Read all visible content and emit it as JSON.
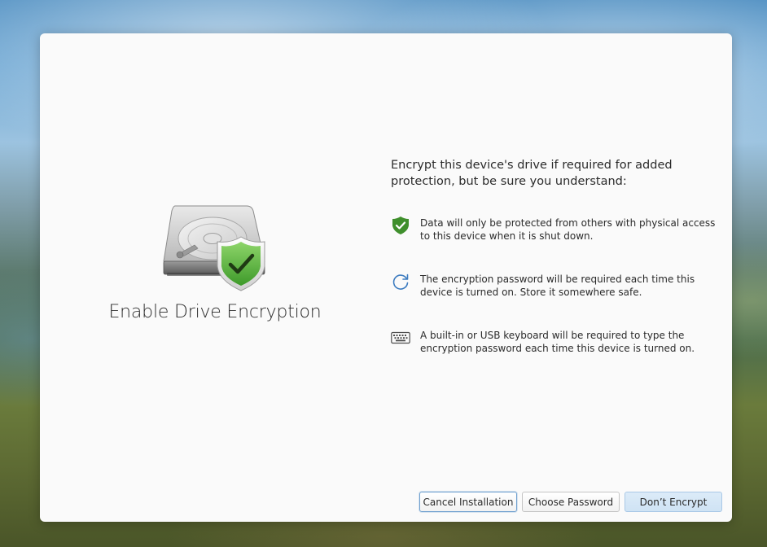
{
  "dialog": {
    "title": "Enable Drive Encryption",
    "intro": "Encrypt this device's drive if required for added protection, but be sure you understand:",
    "items": [
      {
        "icon": "shield-check-icon",
        "text": "Data will only be protected from others with physical access to this device when it is shut down."
      },
      {
        "icon": "refresh-icon",
        "text": "The encryption password will be required each time this device is turned on. Store it somewhere safe."
      },
      {
        "icon": "keyboard-icon",
        "text": "A built-in or USB keyboard will be required to type the encryption password each time this device is turned on."
      }
    ],
    "buttons": {
      "cancel": "Cancel Installation",
      "choose": "Choose Password",
      "dont_encrypt": "Don’t Encrypt"
    }
  },
  "colors": {
    "shield_green": "#3f8f2c",
    "refresh_blue": "#3d7cc0",
    "accent_blue": "#cfe3f4"
  }
}
